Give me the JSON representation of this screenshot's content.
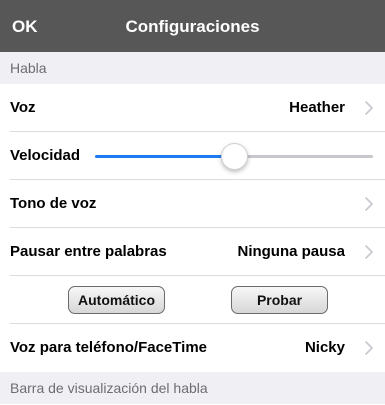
{
  "navbar": {
    "ok_label": "OK",
    "title": "Configuraciones"
  },
  "sections": {
    "speech_header": "Habla",
    "speech_display_header": "Barra de visualización del habla"
  },
  "rows": {
    "voice": {
      "label": "Voz",
      "value": "Heather"
    },
    "speed": {
      "label": "Velocidad",
      "level_fraction": 0.5
    },
    "tone": {
      "label": "Tono de voz"
    },
    "pause": {
      "label": "Pausar entre palabras",
      "value": "Ninguna pausa"
    },
    "phone_voice": {
      "label": "Voz para teléfono/FaceTime",
      "value": "Nicky"
    }
  },
  "buttons": {
    "automatic_label": "Automático",
    "test_label": "Probar"
  },
  "icons": {
    "chevron": "chevron-right-icon"
  },
  "colors": {
    "navbar": "#575757",
    "accent": "#1e7cf2",
    "section_background": "#efeff4"
  }
}
